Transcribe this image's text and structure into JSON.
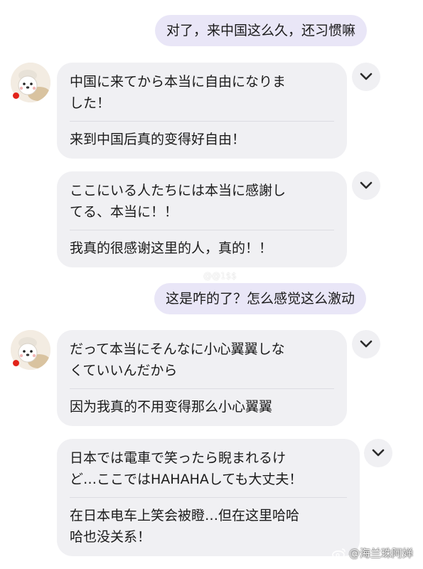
{
  "messages": [
    {
      "side": "out",
      "text": "对了，来中国这么久，还习惯嘛"
    },
    {
      "side": "in",
      "jp": "中国に来てから本当に自由になりました！",
      "zh": "来到中国后真的变得好自由！"
    },
    {
      "side": "in",
      "jp": "ここにいる人たちには本当に感謝してる、本当に！！",
      "zh": "我真的很感谢这里的人，真的！！"
    },
    {
      "side": "out",
      "text": "这是咋的了？怎么感觉这么激动"
    },
    {
      "side": "in",
      "jp": "だって本当にそんなに小心翼翼しなくていいんだから",
      "zh": "因为我真的不用变得那么小心翼翼"
    },
    {
      "side": "in",
      "jp": "日本では電車で笑ったら睨まれるけど…ここではHAHAHAしても大丈夫！",
      "zh": "在日本电车上笑会被瞪…但在这里哈哈哈也没关系！"
    }
  ],
  "display_lines": {
    "m1_l1": "中国に来てから本当に自由になりま",
    "m1_l2": "した！",
    "m2_l1": "ここにいる人たちには本当に感謝し",
    "m2_l2": "てる、本当に！！",
    "m4_l1": "だって本当にそんなに小心翼翼しな",
    "m4_l2": "くていいんだから",
    "m5_l1": "日本では電車で笑ったら睨まれるけ",
    "m5_l2": "ど…ここではHAHAHAしても大丈夫！",
    "m5_zh_l1": "在日本电车上笑会被瞪…但在这里哈哈",
    "m5_zh_l2": "哈也没关系！"
  },
  "watermark": "@海兰珠阿婵",
  "faint_mark": "@@1$$",
  "icons": {
    "avatar": "dog-chef-avatar",
    "expand": "chevron-down-icon",
    "weibo": "weibo-logo"
  },
  "colors": {
    "outgoing_bubble": "#e9e6f7",
    "incoming_bubble": "#f0f0f3",
    "online_dot": "#e2231a"
  }
}
